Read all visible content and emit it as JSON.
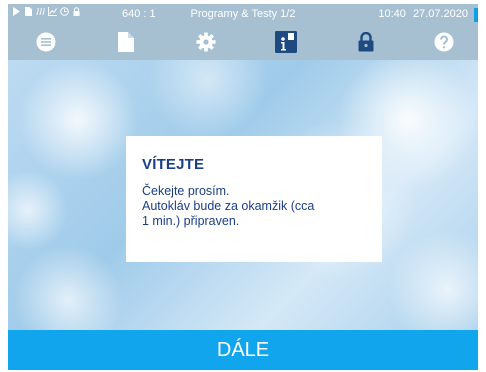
{
  "status_bar": {
    "counter": "640 : 1",
    "title": "Programy & Testy 1/2",
    "time": "10:40",
    "date": "27.07.2020",
    "icons": [
      "play-icon",
      "file-icon",
      "waves-icon",
      "chart-icon",
      "clock-icon",
      "lock-icon"
    ]
  },
  "toolbar": {
    "buttons": [
      {
        "name": "menu-icon"
      },
      {
        "name": "document-icon"
      },
      {
        "name": "gear-icon"
      },
      {
        "name": "info-icon",
        "active": true
      },
      {
        "name": "lock-icon"
      },
      {
        "name": "help-icon"
      }
    ]
  },
  "dialog": {
    "heading": "VÍTEJTE",
    "lines": [
      "Čekejte prosím.",
      "Autokláv bude za okamžik (cca",
      "1 min.) připraven."
    ]
  },
  "footer": {
    "button_label": "DÁLE"
  },
  "colors": {
    "status_bg": "#a6c0d2",
    "accent": "#11a5ee",
    "dialog_text": "#1b3f86",
    "active_icon": "#1d4a80"
  }
}
